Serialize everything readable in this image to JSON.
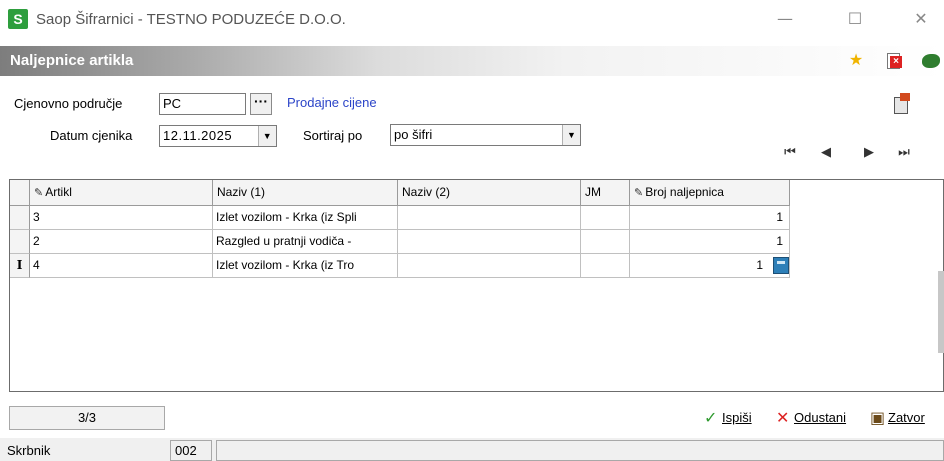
{
  "window": {
    "logo_letter": "S",
    "title": "Saop Šifrarnici - TESTNO PODUZEĆE D.O.O.",
    "minimize": "—",
    "maximize": "☐",
    "close": "✕"
  },
  "header": {
    "title": "Naljepnice artikla",
    "icons": [
      "star-icon",
      "document-close-icon",
      "exit-icon"
    ]
  },
  "form": {
    "price_area_label": "Cjenovno područje",
    "price_area_value": "PC",
    "lookup_button": "···",
    "price_area_name": "Prodajne cijene",
    "price_date_label": "Datum cjenika",
    "price_date_value": "12.11.2025",
    "sort_label": "Sortiraj po",
    "sort_value": "po šifri",
    "dropdown_arrow": "▼"
  },
  "navigation": {
    "first": "⏮",
    "prev": "◀",
    "next": "▶",
    "last": "⏭"
  },
  "grid": {
    "edit_marker": "✎",
    "columns": [
      "Artikl",
      "Naziv (1)",
      "Naziv (2)",
      "JM",
      "Broj naljepnica"
    ],
    "current_row_marker": "I",
    "rows": [
      {
        "artikl": "3",
        "naziv1": "Izlet vozilom - Krka (iz Spli",
        "naziv2": "",
        "jm": "",
        "broj": "1"
      },
      {
        "artikl": "2",
        "naziv1": "Razgled u pratnji vodiča -",
        "naziv2": "",
        "jm": "",
        "broj": "1"
      },
      {
        "artikl": "4",
        "naziv1": "Izlet vozilom - Krka (iz Tro",
        "naziv2": "",
        "jm": "",
        "broj": "1"
      }
    ]
  },
  "footer": {
    "record_counter": "3/3",
    "print_label": "Ispiši",
    "cancel_label": "Odustani",
    "close_label": "Zatvor",
    "print_icon": "✓",
    "cancel_icon": "✕",
    "close_icon": "▣"
  },
  "statusbar": {
    "user": "Skrbnik",
    "code": "002",
    "message": ""
  }
}
